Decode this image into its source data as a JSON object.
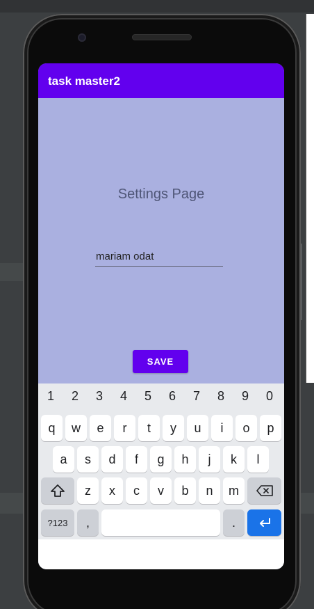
{
  "app": {
    "title": "task master2"
  },
  "settings": {
    "heading": "Settings Page",
    "name_value": "mariam odat",
    "save_label": "SAVE"
  },
  "keyboard": {
    "number_row": [
      "1",
      "2",
      "3",
      "4",
      "5",
      "6",
      "7",
      "8",
      "9",
      "0"
    ],
    "row1": [
      "q",
      "w",
      "e",
      "r",
      "t",
      "y",
      "u",
      "i",
      "o",
      "p"
    ],
    "row2": [
      "a",
      "s",
      "d",
      "f",
      "g",
      "h",
      "j",
      "k",
      "l"
    ],
    "row3": [
      "z",
      "x",
      "c",
      "v",
      "b",
      "n",
      "m"
    ],
    "symbols_label": "?123",
    "comma": ",",
    "period": ".",
    "icons": {
      "shift": "shift-icon",
      "backspace": "backspace-icon",
      "enter": "enter-icon"
    }
  },
  "colors": {
    "primary": "#6200ee",
    "background": "#aab0e0",
    "keyboard_bg": "#e8eaed",
    "enter_key": "#1a73e8"
  }
}
